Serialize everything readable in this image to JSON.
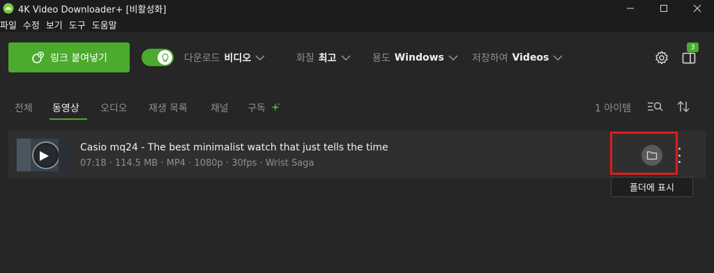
{
  "window": {
    "title": "4K Video Downloader+ [비활성화]"
  },
  "menu": [
    "파일",
    "수정",
    "보기",
    "도구",
    "도움말"
  ],
  "toolbar": {
    "paste_label": "링크 붙여넣기",
    "smart_mode": "on",
    "download": {
      "label": "다운로드",
      "value": "비디오"
    },
    "quality": {
      "label": "화질",
      "value": "최고"
    },
    "purpose": {
      "label": "용도",
      "value": "Windows"
    },
    "save_to": {
      "label": "저장하여",
      "value": "Videos"
    },
    "badge_count": "3"
  },
  "tabs": {
    "items": [
      "전체",
      "동영상",
      "오디오",
      "재생 목록",
      "채널",
      "구독"
    ],
    "active": "동영상",
    "item_count": "1 아이템"
  },
  "downloads": [
    {
      "title": "Casio mq24 - The best minimalist watch that just tells the time",
      "meta": "07:18 · 114.5 MB · MP4 · 1080p · 30fps · Wrist Saga"
    }
  ],
  "tooltip": "폴더에 표시",
  "colors": {
    "accent": "#4aab2c",
    "background": "#262626",
    "row": "#2f2f2f",
    "highlight": "#e31b1b"
  }
}
